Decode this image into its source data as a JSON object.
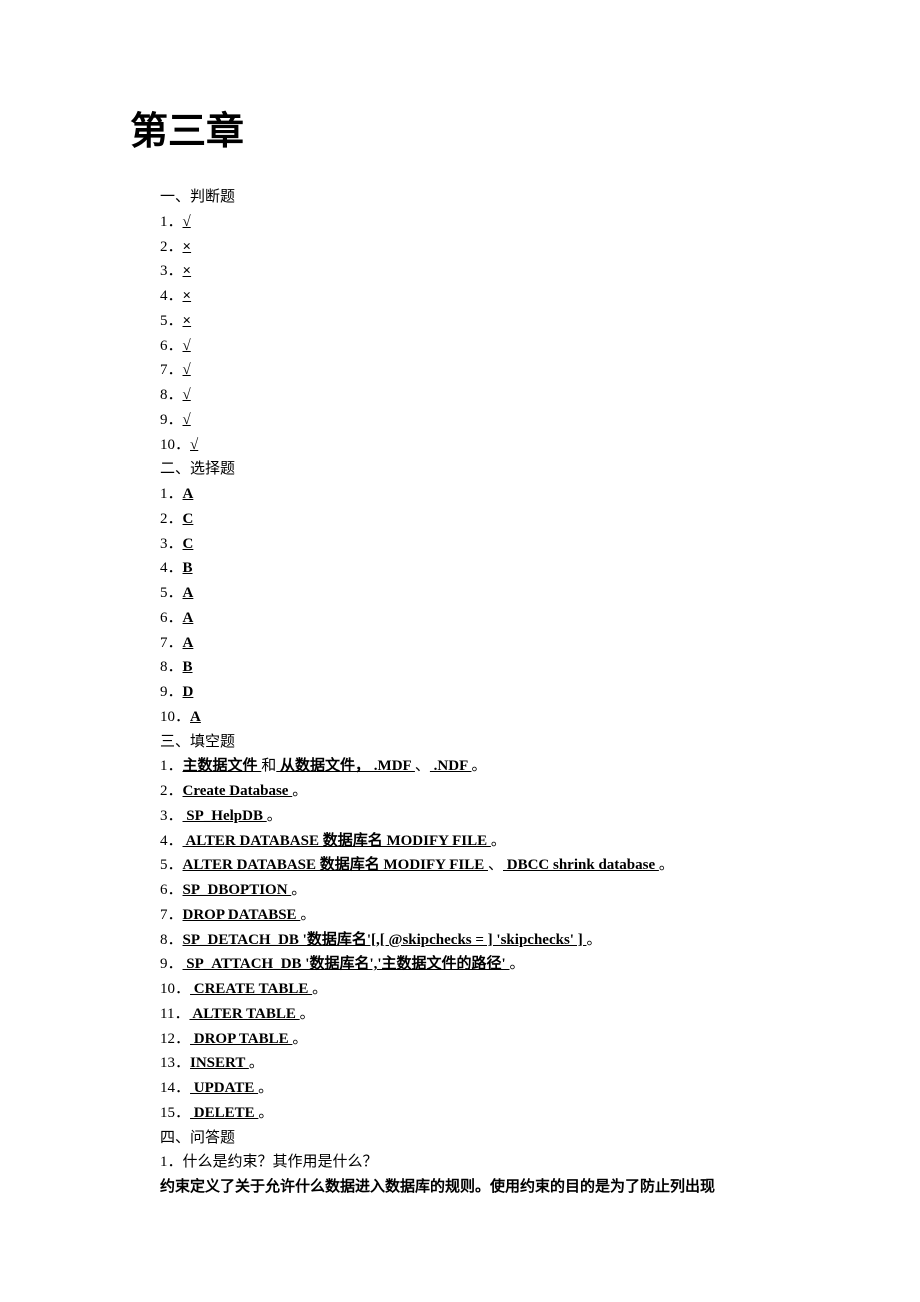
{
  "title": "第三章",
  "sections": {
    "judge": {
      "header": "一、判断题",
      "items": [
        {
          "n": "1．",
          "a": "√"
        },
        {
          "n": "2．",
          "a": "×"
        },
        {
          "n": "3．",
          "a": "×"
        },
        {
          "n": "4．",
          "a": "×"
        },
        {
          "n": "5．",
          "a": "×"
        },
        {
          "n": "6．",
          "a": "√"
        },
        {
          "n": "7．",
          "a": "√"
        },
        {
          "n": "8．",
          "a": "√"
        },
        {
          "n": "9．",
          "a": "√"
        },
        {
          "n": "10．",
          "a": "√"
        }
      ]
    },
    "choice": {
      "header": "二、选择题",
      "items": [
        {
          "n": "1．",
          "a": "A"
        },
        {
          "n": "2．",
          "a": "C"
        },
        {
          "n": "3．",
          "a": "C"
        },
        {
          "n": "4．",
          "a": "B"
        },
        {
          "n": "5．",
          "a": "A"
        },
        {
          "n": "6．",
          "a": "A"
        },
        {
          "n": "7．",
          "a": "A"
        },
        {
          "n": "8．",
          "a": "B"
        },
        {
          "n": "9．",
          "a": "D"
        },
        {
          "n": "10．",
          "a": "A"
        }
      ]
    },
    "fill": {
      "header": "三、填空题",
      "items": [
        {
          "n": "1．",
          "parts": [
            {
              "t": "主数据文件        ",
              "u": true
            },
            {
              "t": "和",
              "u": false
            },
            {
              "t": "     从数据文件，  .MDF           ",
              "u": true
            },
            {
              "t": "、",
              "u": false
            },
            {
              "t": "       .NDF           ",
              "u": true
            },
            {
              "t": "。",
              "u": false
            }
          ]
        },
        {
          "n": "2．",
          "parts": [
            {
              "t": "Create Database           ",
              "u": true
            },
            {
              "t": "。",
              "u": false
            }
          ]
        },
        {
          "n": "3．",
          "parts": [
            {
              "t": "  SP_HelpDB       ",
              "u": true
            },
            {
              "t": "。",
              "u": false
            }
          ]
        },
        {
          "n": "4．",
          "parts": [
            {
              "t": "   ALTER DATABASE  数据库名    MODIFY FILE        ",
              "u": true
            },
            {
              "t": "。",
              "u": false
            }
          ]
        },
        {
          "n": "5．",
          "parts": [
            {
              "t": "ALTER DATABASE  数据库名    MODIFY FILE        ",
              "u": true
            },
            {
              "t": "、",
              "u": false
            },
            {
              "t": "    DBCC shrink database            ",
              "u": true
            },
            {
              "t": "。",
              "u": false
            }
          ]
        },
        {
          "n": "6．",
          "parts": [
            {
              "t": "SP_DBOPTION          ",
              "u": true
            },
            {
              "t": "。",
              "u": false
            }
          ]
        },
        {
          "n": "7．",
          "parts": [
            {
              "t": "DROP DATABSE           ",
              "u": true
            },
            {
              "t": "。",
              "u": false
            }
          ]
        },
        {
          "n": "8．",
          "parts": [
            {
              "t": "SP_DETACH_DB     '数据库名'[,[ @skipchecks = ] 'skipchecks' ]        ",
              "u": true
            },
            {
              "t": "。",
              "u": false
            }
          ]
        },
        {
          "n": "9．",
          "parts": [
            {
              "t": "  SP_ATTACH_DB    '数据库名','主数据文件的路径'          ",
              "u": true
            },
            {
              "t": "。",
              "u": false
            }
          ]
        },
        {
          "n": "10．",
          "parts": [
            {
              "t": " CREATE TABLE          ",
              "u": true
            },
            {
              "t": "。",
              "u": false
            }
          ]
        },
        {
          "n": "11．",
          "parts": [
            {
              "t": " ALTER TABLE           ",
              "u": true
            },
            {
              "t": "。",
              "u": false
            }
          ]
        },
        {
          "n": "12．",
          "parts": [
            {
              "t": " DROP TABLE          ",
              "u": true
            },
            {
              "t": "。",
              "u": false
            }
          ]
        },
        {
          "n": "13．",
          "parts": [
            {
              "t": "INSERT         ",
              "u": true
            },
            {
              "t": "。",
              "u": false
            }
          ]
        },
        {
          "n": "14．",
          "parts": [
            {
              "t": " UPDATE       ",
              "u": true
            },
            {
              "t": "。",
              "u": false
            }
          ]
        },
        {
          "n": "15．",
          "parts": [
            {
              "t": " DELETE        ",
              "u": true
            },
            {
              "t": "。",
              "u": false
            }
          ]
        }
      ]
    },
    "qa": {
      "header": "四、问答题",
      "q1_num": "1．",
      "q1_text": "什么是约束？其作用是什么？",
      "q1_answer": "约束定义了关于允许什么数据进入数据库的规则。使用约束的目的是为了防止列出现"
    }
  }
}
